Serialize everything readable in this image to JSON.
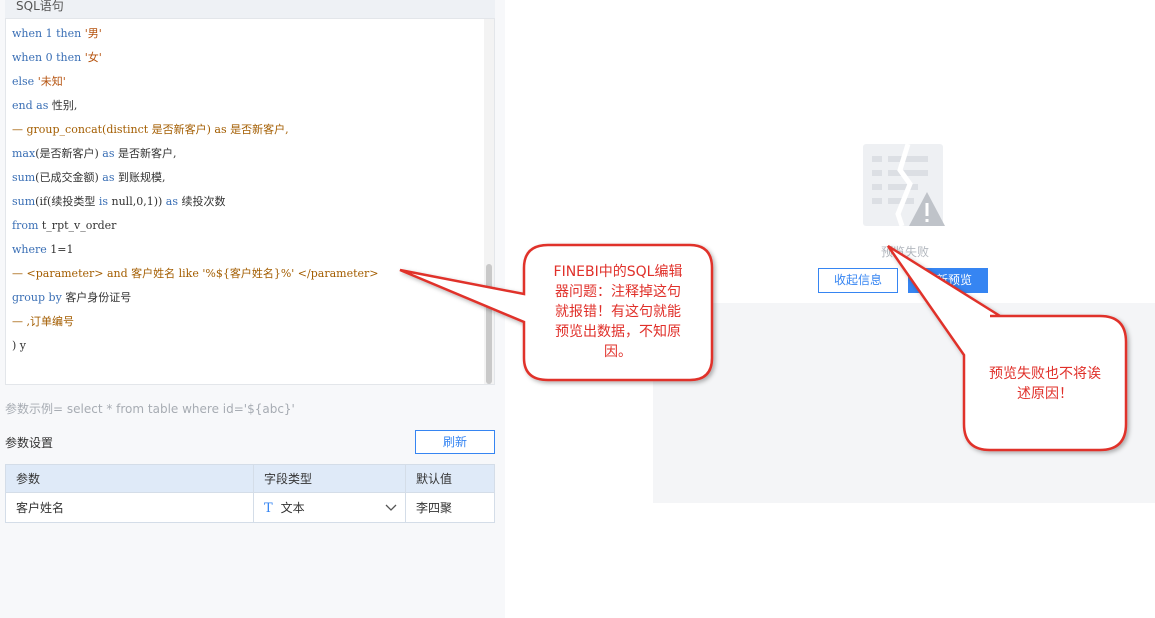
{
  "sql_section": {
    "header": "SQL语句",
    "lines": [
      [
        {
          "t": "when 1 then ",
          "c": "kw"
        },
        {
          "t": "'男'",
          "c": "str"
        }
      ],
      [
        {
          "t": "when 0 then ",
          "c": "kw"
        },
        {
          "t": "'女'",
          "c": "str"
        }
      ],
      [
        {
          "t": "else ",
          "c": "kw"
        },
        {
          "t": "'未知'",
          "c": "str"
        }
      ],
      [
        {
          "t": "end ",
          "c": "kw"
        },
        {
          "t": "as ",
          "c": "kw"
        },
        {
          "t": "性别,",
          "c": ""
        }
      ],
      [
        {
          "t": "— group_concat(distinct 是否新客户) as 是否新客户,",
          "c": "cm"
        }
      ],
      [
        {
          "t": "max",
          "c": "fn"
        },
        {
          "t": "(是否新客户) ",
          "c": ""
        },
        {
          "t": "as ",
          "c": "kw"
        },
        {
          "t": "是否新客户,",
          "c": ""
        }
      ],
      [
        {
          "t": "sum",
          "c": "fn"
        },
        {
          "t": "(已成交金额) ",
          "c": ""
        },
        {
          "t": "as ",
          "c": "kw"
        },
        {
          "t": "到账规模,",
          "c": ""
        }
      ],
      [
        {
          "t": "sum",
          "c": "fn"
        },
        {
          "t": "(if(续投类型 ",
          "c": ""
        },
        {
          "t": "is ",
          "c": "kw"
        },
        {
          "t": "null,0,1)) ",
          "c": ""
        },
        {
          "t": "as ",
          "c": "kw"
        },
        {
          "t": "续投次数",
          "c": ""
        }
      ],
      [
        {
          "t": "from ",
          "c": "kw"
        },
        {
          "t": "t_rpt_v_order",
          "c": ""
        }
      ],
      [
        {
          "t": "where ",
          "c": "kw"
        },
        {
          "t": "1=1",
          "c": ""
        }
      ],
      [
        {
          "t": "— <parameter> and 客户姓名 like '%${客户姓名}%' </parameter>",
          "c": "cm"
        }
      ],
      [
        {
          "t": "group by ",
          "c": "kw"
        },
        {
          "t": "客户身份证号",
          "c": ""
        }
      ],
      [
        {
          "t": "— ,订单编号",
          "c": "cm"
        }
      ],
      [
        {
          "t": ") y",
          "c": ""
        }
      ]
    ]
  },
  "hint": "参数示例= select * from table where id='${abc}'",
  "params": {
    "title": "参数设置",
    "refresh_label": "刷新",
    "columns": [
      "参数",
      "字段类型",
      "默认值"
    ],
    "rows": [
      {
        "name": "客户姓名",
        "type_icon": "T",
        "type": "文本",
        "default": "李四聚"
      }
    ]
  },
  "preview": {
    "fail_text": "预览失败",
    "collapse_label": "收起信息",
    "repreview_label": "重新预览"
  },
  "annotations": {
    "left_bubble_lines": [
      "FINEBI中的SQL编辑",
      "器问题：注释掉这句",
      "就报错！有这句就能",
      "预览出数据，不知原",
      "因。"
    ],
    "right_bubble_lines": [
      "预览失败也不将诶",
      "述原因！"
    ]
  },
  "colors": {
    "accent": "#3685f2",
    "annotation_red": "#e0302a"
  }
}
